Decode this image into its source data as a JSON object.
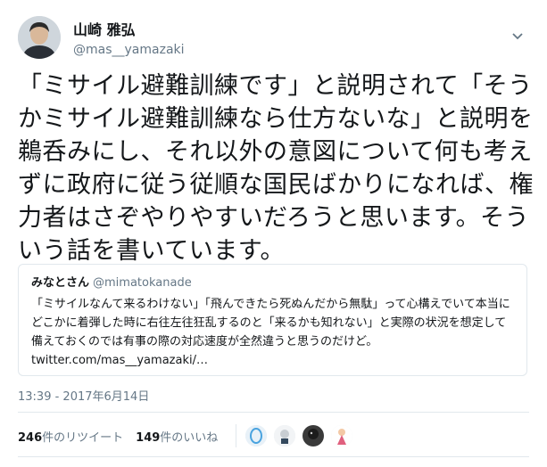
{
  "author": {
    "display_name": "山崎 雅弘",
    "handle": "@mas__yamazaki"
  },
  "tweet": {
    "text": "「ミサイル避難訓練です」と説明されて「そうかミサイル避難訓練なら仕方ないな」と説明を鵜呑みにし、それ以外の意図について何も考えずに政府に従う従順な国民ばかりになれば、権力者はさぞやりやすいだろうと思います。そういう話を書いています。"
  },
  "quoted_tweet": {
    "display_name": "みなとさん",
    "handle": "@mimatokanade",
    "text": "「ミサイルなんて来るわけない」「飛んできたら死ぬんだから無駄」って心構えでいて本当にどこかに着弾した時に右往左往狂乱するのと「来るかも知れない」と実際の状況を想定して備えておくのでは有事の際の対応速度が全然違うと思うのだけど。",
    "link": "twitter.com/mas__yamazaki/…"
  },
  "timestamp": "13:39 - 2017年6月14日",
  "stats": {
    "retweets_count": "246",
    "retweets_label": "件のリツイート",
    "likes_count": "149",
    "likes_label": "件のいいね"
  },
  "colors": {
    "text": "#14171a",
    "secondary": "#657786",
    "border": "#e1e8ed"
  }
}
